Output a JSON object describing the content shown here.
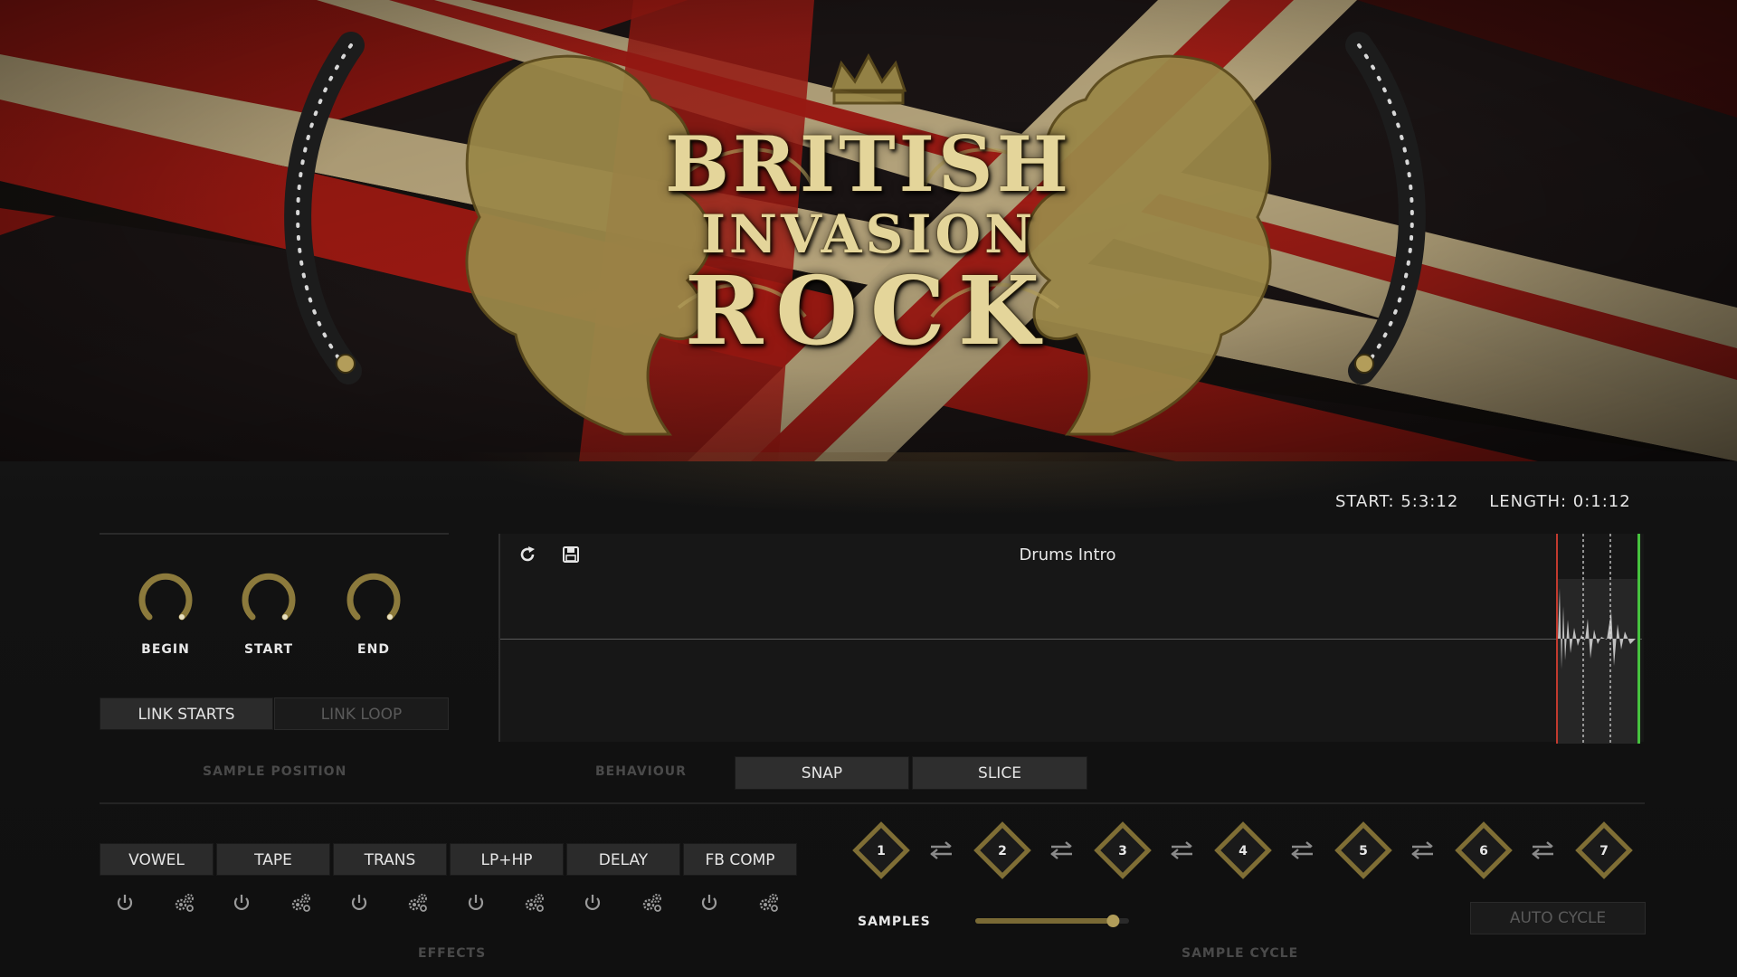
{
  "header": {
    "title_line_1": "BRITISH",
    "title_line_2": "INVASION",
    "title_line_3": "ROCK"
  },
  "readout": {
    "start": "START: 5:3:12",
    "length": "LENGTH: 0:1:12"
  },
  "sample_position": {
    "label": "SAMPLE POSITION",
    "knobs": [
      {
        "label": "BEGIN"
      },
      {
        "label": "START"
      },
      {
        "label": "END"
      }
    ],
    "link_starts": "LINK STARTS",
    "link_loop": "LINK LOOP"
  },
  "editor": {
    "sample_name": "Drums Intro"
  },
  "behaviour": {
    "label": "BEHAVIOUR",
    "snap": "SNAP",
    "slice": "SLICE"
  },
  "effects": {
    "label": "EFFECTS",
    "items": [
      "VOWEL",
      "TAPE",
      "TRANS",
      "LP+HP",
      "DELAY",
      "FB COMP"
    ]
  },
  "sample_cycle": {
    "label": "SAMPLE CYCLE",
    "slots": [
      "1",
      "2",
      "3",
      "4",
      "5",
      "6",
      "7"
    ],
    "samples_label": "SAMPLES",
    "samples_level": 0.92,
    "auto_cycle": "AUTO CYCLE"
  },
  "colors": {
    "gold": "#a0904a",
    "flag_red": "#9c1a14",
    "flag_cream": "#bfae83",
    "panel_bg": "#121212"
  }
}
